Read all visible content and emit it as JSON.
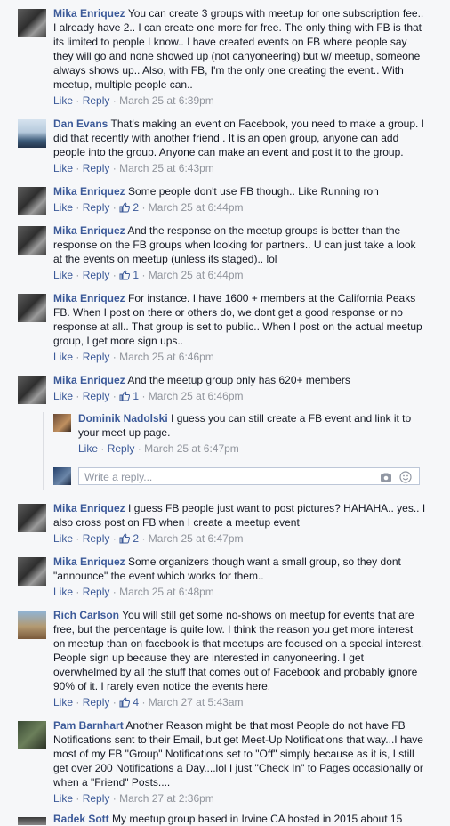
{
  "labels": {
    "like": "Like",
    "reply": "Reply",
    "dot": "·"
  },
  "colors": {
    "link": "#3b5998",
    "meta": "#90949c",
    "background": "#f6f7f9"
  },
  "comments": [
    {
      "author": "Mika Enriquez",
      "text": "You can create 3 groups with meetup for one subscription fee.. I already have 2.. I can create one more for free. The only thing with FB is that its limited to people I know.. I have created events on FB where people say they will go and none showed up (not canyoneering) but w/ meetup, someone always shows up.. Also, with FB, I'm the only one creating the event.. With meetup, multiple people can..",
      "time": "March 25 at 6:39pm",
      "likes": ""
    },
    {
      "author": "Dan Evans",
      "text": "That's making an event on Facebook, you need to make a group. I did that recently with another friend . It is an open group, anyone can add people into the group. Anyone can make an event and post it to the group.",
      "time": "March 25 at 6:43pm",
      "likes": ""
    },
    {
      "author": "Mika Enriquez",
      "text": "Some people don't use FB though.. Like Running ron",
      "time": "March 25 at 6:44pm",
      "likes": "2"
    },
    {
      "author": "Mika Enriquez",
      "text": "And the response on the meetup groups is better than the response on the FB groups when looking for partners.. U can just take a look at the events on meetup (unless its staged).. lol",
      "time": "March 25 at 6:44pm",
      "likes": "1"
    },
    {
      "author": "Mika Enriquez",
      "text": "For instance. I have 1600 + members at the California Peaks FB. When I post on there or others do, we dont get a good response or no response at all.. That group is set to public.. When I post on the actual meetup group, I get more sign ups..",
      "time": "March 25 at 6:46pm",
      "likes": ""
    },
    {
      "author": "Mika Enriquez",
      "text": "And the meetup group only has 620+ members",
      "time": "March 25 at 6:46pm",
      "likes": "1"
    },
    {
      "author": "Mika Enriquez",
      "text": "I guess FB people just want to post pictures? HAHAHA.. yes.. I also cross post on FB when I create a meetup event",
      "time": "March 25 at 6:47pm",
      "likes": "2"
    },
    {
      "author": "Mika Enriquez",
      "text": "Some organizers though want a small group, so they dont \"announce\" the event which works for them..",
      "time": "March 25 at 6:48pm",
      "likes": ""
    },
    {
      "author": "Rich Carlson",
      "text": "You will still get some no-shows on meetup for events that are free, but the percentage is quite low. I think the reason you get more interest on meetup than on facebook is that meetups are focused on a special interest. People sign up because they are interested in canyoneering. I get overwhelmed by all the stuff that comes out of Facebook and probably ignore 90% of it. I rarely even notice the events here.",
      "time": "March 27 at 5:43am",
      "likes": "4"
    },
    {
      "author": "Pam Barnhart",
      "text": "Another Reason might be that most People do not have FB Notifications sent to their Email, but get Meet-Up Notifications that way...I have most of my FB \"Group\" Notifications set to \"Off\" simply because as it is, I still get over 200 Notifications a Day....lol I just \"Check In\" to Pages occasionally or when a \"Friend\" Posts....",
      "time": "March 27 at 2:36pm",
      "likes": ""
    }
  ],
  "reply": {
    "author": "Dominik Nadolski",
    "text": "I guess you can still create a FB event and link it to your meet up page.",
    "time": "March 25 at 6:47pm"
  },
  "reply_box": {
    "placeholder": "Write a reply...",
    "camera_icon": "camera-icon",
    "emoji_icon": "emoji-icon"
  },
  "partial": {
    "author": "Radek Sott",
    "text": "My meetup group based in Irvine CA hosted in 2015 about 15"
  }
}
